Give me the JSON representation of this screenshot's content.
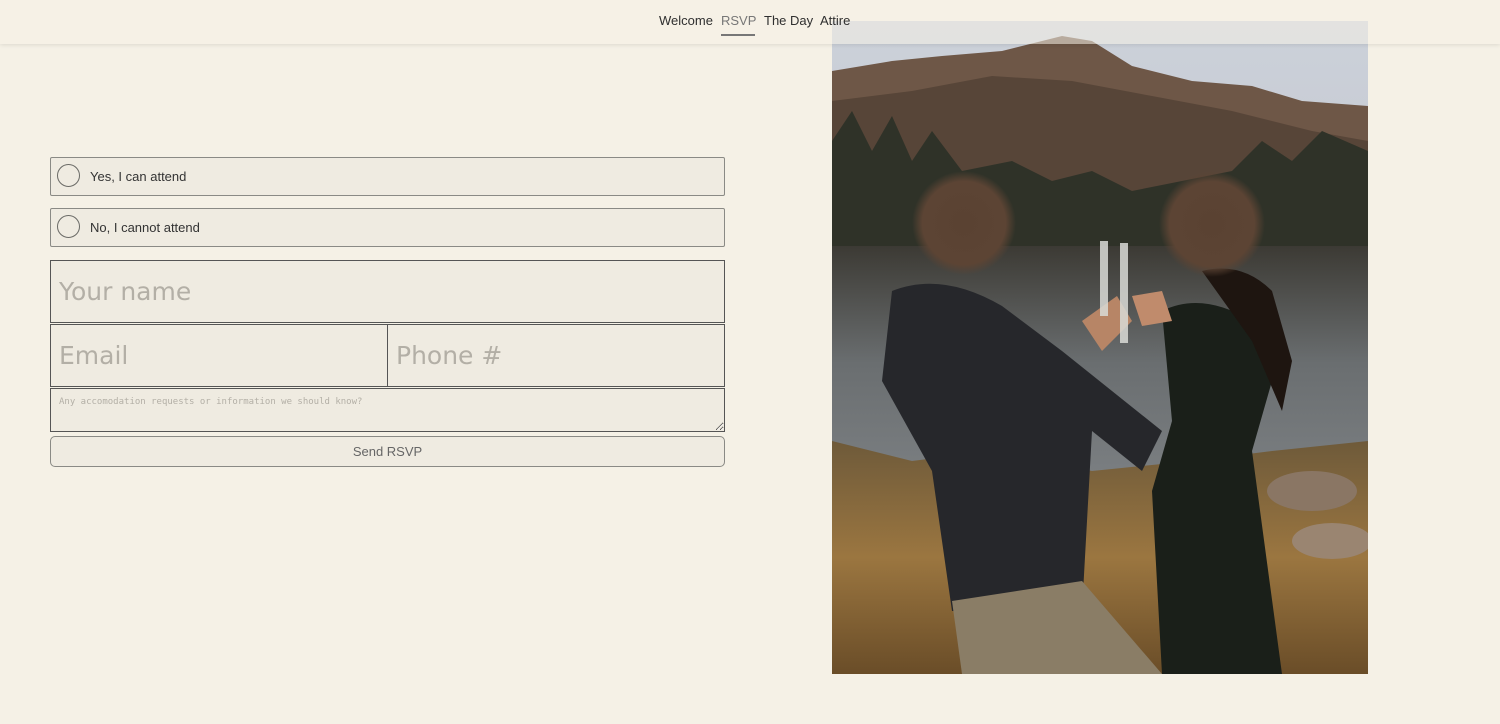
{
  "nav": {
    "items": [
      {
        "label": "Welcome",
        "active": false
      },
      {
        "label": "RSVP",
        "active": true
      },
      {
        "label": "The Day",
        "active": false
      },
      {
        "label": "Attire",
        "active": false
      }
    ]
  },
  "rsvp_form": {
    "options": [
      {
        "label": "Yes, I can attend",
        "selected": false
      },
      {
        "label": "No, I cannot attend",
        "selected": false
      }
    ],
    "name_placeholder": "Your name",
    "email_placeholder": "Email",
    "phone_placeholder": "Phone #",
    "notes_placeholder": "Any accomodation requests or information we should know?",
    "submit_label": "Send RSVP"
  },
  "colors": {
    "background": "#f5f1e6",
    "field_background": "#efebe1",
    "active_nav": "#777777"
  }
}
